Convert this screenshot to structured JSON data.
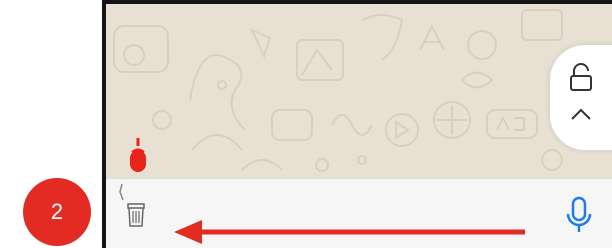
{
  "step": {
    "number": "2",
    "color": "#e32b24"
  },
  "icons": {
    "lock": "lock-icon",
    "chevron": "chevron-up-icon",
    "recording": "recording-mic-icon",
    "trash": "trash-icon",
    "mic": "microphone-icon",
    "arrow": "arrow-left-icon"
  },
  "colors": {
    "accent_blue": "#1a7cf0",
    "recording_red": "#e8241b",
    "annotation_red": "#e32b24",
    "wallpaper": "#e9e0d4"
  }
}
